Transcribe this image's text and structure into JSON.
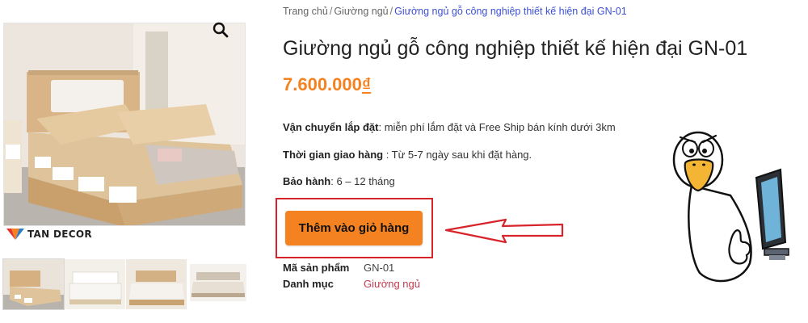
{
  "breadcrumb": [
    {
      "label": "Trang chủ",
      "sep": "/"
    },
    {
      "label": "Giường ngủ",
      "sep": "/"
    },
    {
      "label": "Giường ngủ gỗ công nghiệp thiết kế hiện đại GN-01"
    }
  ],
  "product": {
    "title": "Giường ngủ gỗ công nghiệp thiết kế hiện đại GN-01",
    "price": "7.600.000",
    "currency": "₫"
  },
  "specs": [
    {
      "label": "Vận chuyển lắp đặt",
      "value": ": miễn phí lắm đặt và Free Ship bán kính dưới 3km"
    },
    {
      "label": "Thời gian giao hàng",
      "value": " : Từ 5-7 ngày sau khi đặt hàng."
    },
    {
      "label": "Bảo hành",
      "value": ": 6 – 12 tháng"
    }
  ],
  "cart": {
    "label": "Thêm vào giỏ hàng"
  },
  "meta": {
    "sku_label": "Mã sản phẩm",
    "sku_value": "GN-01",
    "category_label": "Danh mục",
    "category_value": "Giường ngủ"
  },
  "brand": {
    "name": "TAN DECOR"
  },
  "colors": {
    "accent_orange": "#f58220",
    "highlight_red": "#d7242a",
    "link_blue": "#3d50d6",
    "category_pink": "#c43b4e"
  },
  "icons": {
    "zoom": "search-icon",
    "arrow": "left-arrow-annotation",
    "mascot": "duck-computer-mascot"
  }
}
